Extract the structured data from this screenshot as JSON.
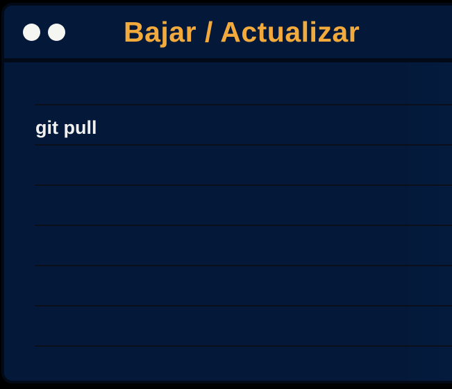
{
  "window": {
    "title": "Bajar / Actualizar",
    "controls": [
      {
        "icon": "window-dot-icon"
      },
      {
        "icon": "window-dot-icon"
      }
    ]
  },
  "content": {
    "lines": [
      "git pull",
      "",
      "",
      "",
      "",
      "",
      ""
    ]
  },
  "colors": {
    "background": "#04193a",
    "border": "#020a18",
    "title": "#f3aa3c",
    "text": "#f0f0f0",
    "dots": "#f5f5f2"
  }
}
